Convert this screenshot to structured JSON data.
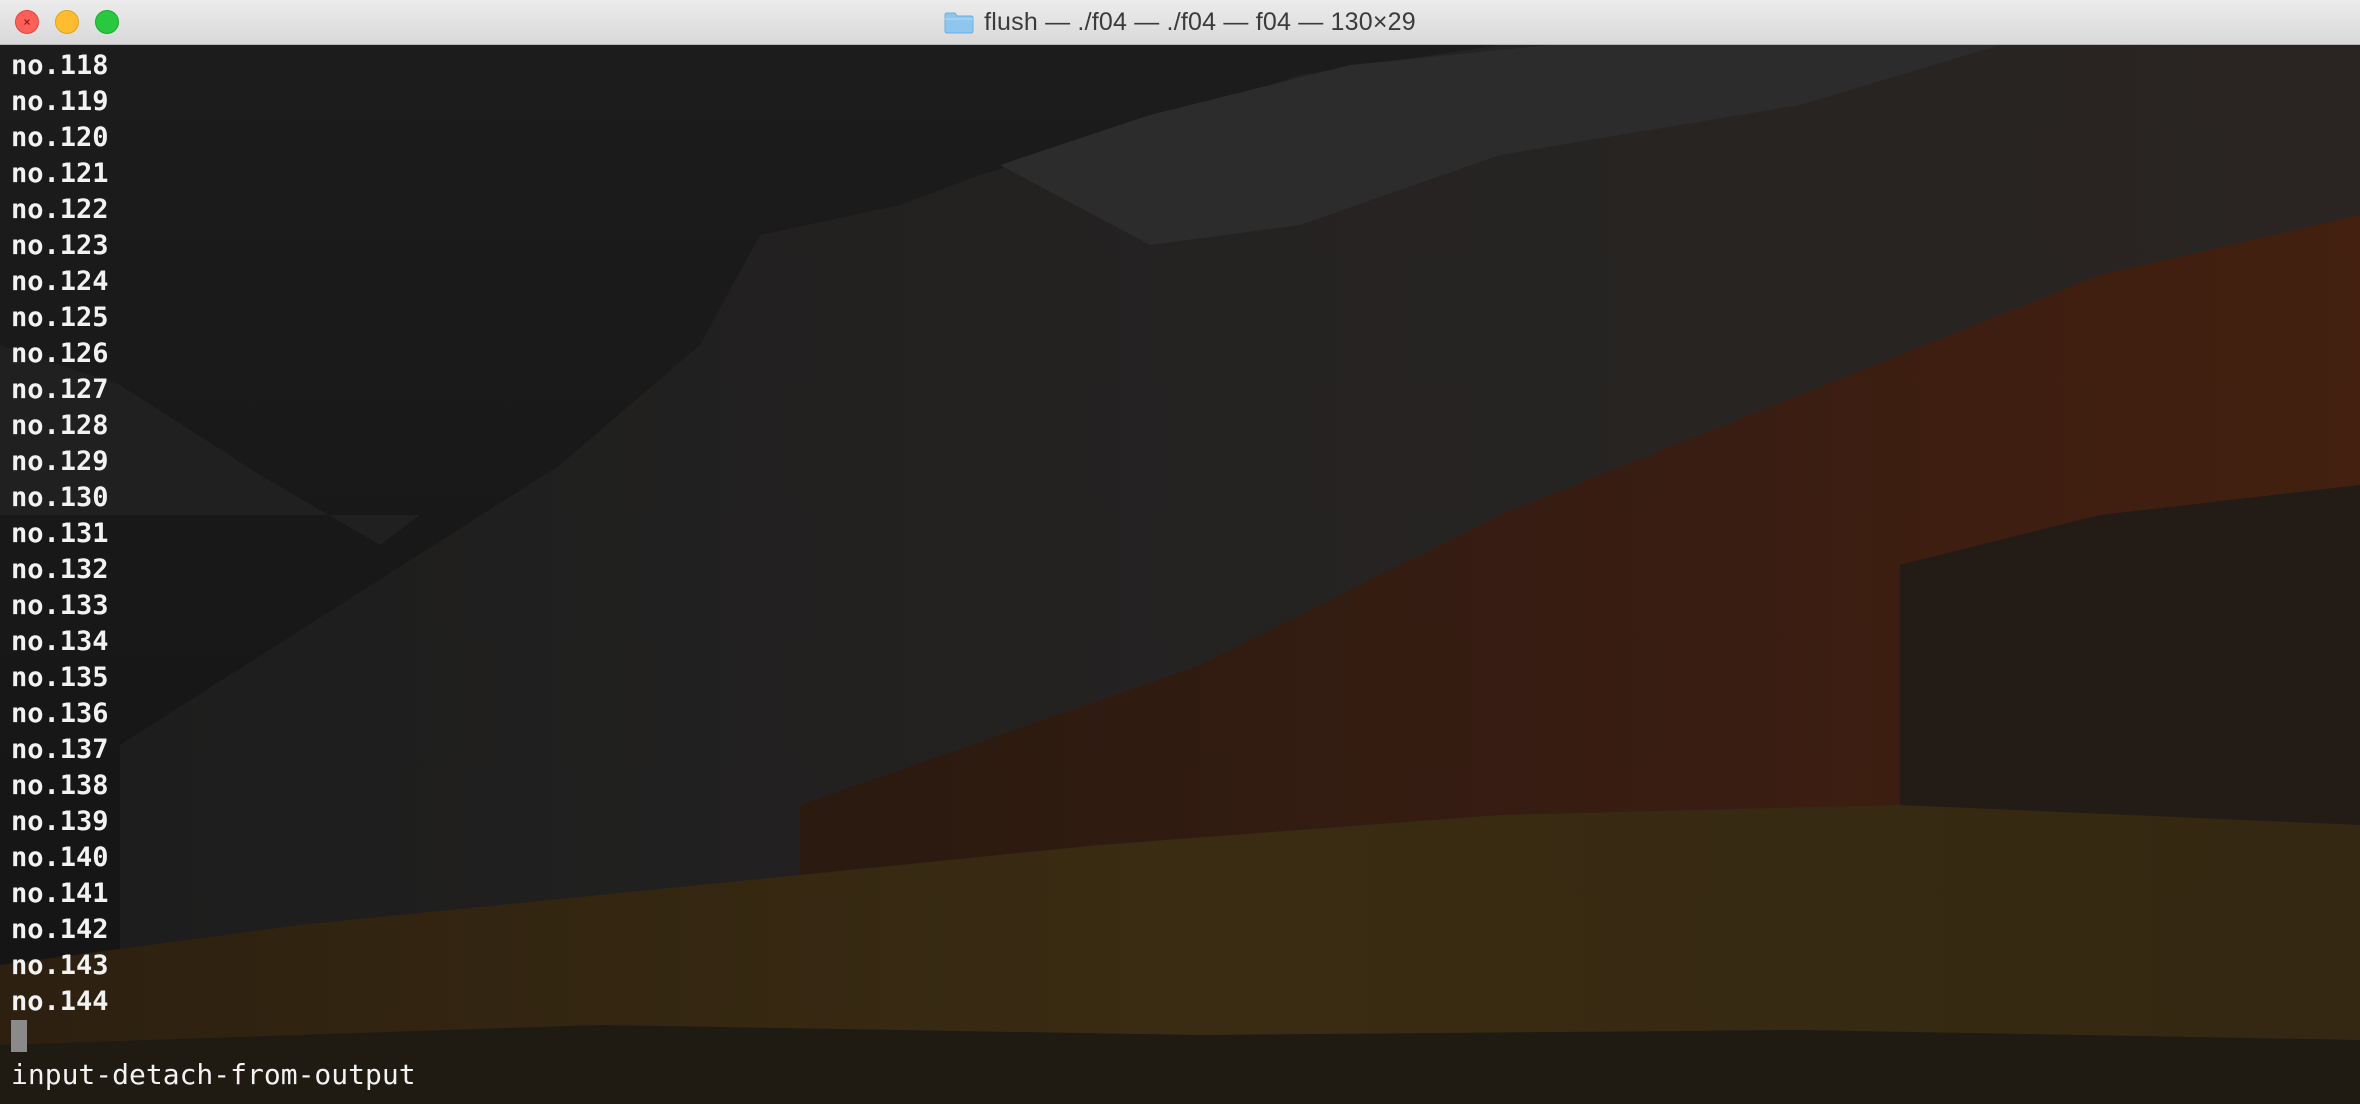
{
  "window": {
    "title": "flush — ./f04 — ./f04 — f04 — 130×29",
    "folder_icon": "folder-icon",
    "colors": {
      "close": "#fe5f57",
      "minimize": "#febc2e",
      "maximize": "#28c840"
    }
  },
  "terminal": {
    "lines": [
      "no.118",
      "no.119",
      "no.120",
      "no.121",
      "no.122",
      "no.123",
      "no.124",
      "no.125",
      "no.126",
      "no.127",
      "no.128",
      "no.129",
      "no.130",
      "no.131",
      "no.132",
      "no.133",
      "no.134",
      "no.135",
      "no.136",
      "no.137",
      "no.138",
      "no.139",
      "no.140",
      "no.141",
      "no.142",
      "no.143",
      "no.144"
    ],
    "status_line": "input-detach-from-output",
    "text_color": "#f2f2f2"
  }
}
